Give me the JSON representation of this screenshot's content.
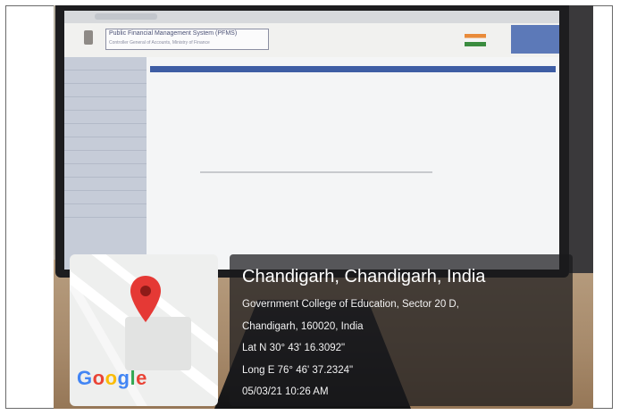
{
  "photo": {
    "screen": {
      "site_title": "Public Financial Management System (PFMS)",
      "site_subtitle": "Controller General of Accounts, Ministry of Finance"
    }
  },
  "map": {
    "brand": "Google",
    "icon": "location-pin-icon"
  },
  "geotag": {
    "place": "Chandigarh, Chandigarh, India",
    "address_line1": "Government College of Education, Sector 20 D,",
    "address_line2": "Chandigarh, 160020, India",
    "latitude": "Lat N 30° 43' 16.3092\"",
    "longitude": "Long E 76° 46' 37.2324\"",
    "datetime": "05/03/21 10:26 AM"
  },
  "colors": {
    "pin_red": "#e53935",
    "google_blue": "#4285F4",
    "google_red": "#EA4335",
    "google_yellow": "#FBBC05",
    "google_green": "#34A853"
  }
}
